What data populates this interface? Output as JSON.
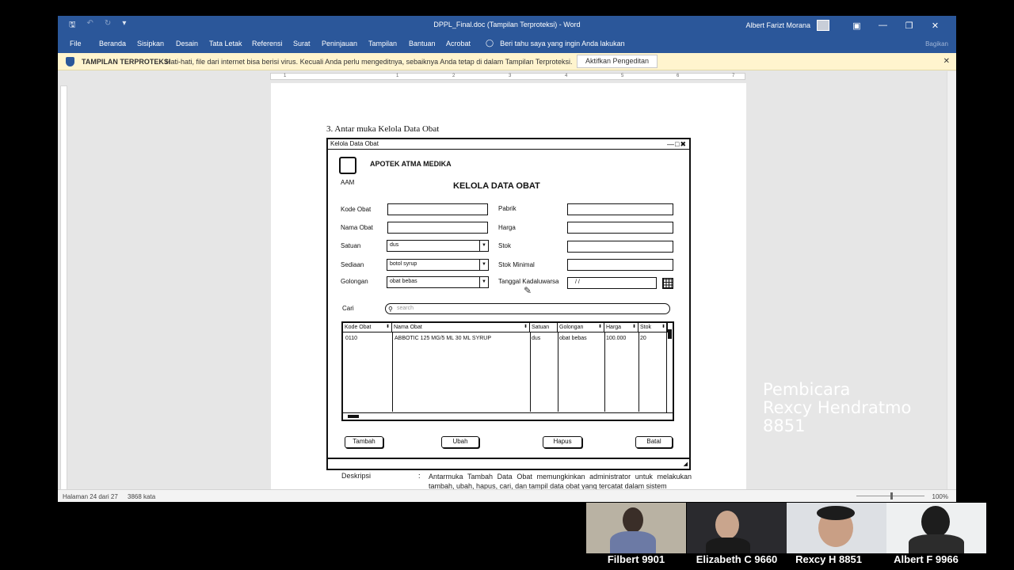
{
  "window": {
    "title": "DPPL_Final.doc (Tampilan Terproteksi) - Word",
    "user": "Albert Farizt Morana"
  },
  "menu": {
    "items": [
      "File",
      "Beranda",
      "Sisipkan",
      "Desain",
      "Tata Letak",
      "Referensi",
      "Surat",
      "Peninjauan",
      "Tampilan",
      "Bantuan",
      "Acrobat"
    ],
    "tell_me": "Beri tahu saya yang ingin Anda lakukan",
    "share": "Bagikan"
  },
  "infobar": {
    "title": "TAMPILAN TERPROTEKSI",
    "message": "Hati-hati, file dari internet bisa berisi virus. Kecuali Anda perlu mengeditnya, sebaiknya Anda tetap di dalam Tampilan Terproteksi.",
    "button": "Aktifkan Pengeditan"
  },
  "ruler": {
    "marks": [
      "1",
      "1",
      "2",
      "3",
      "4",
      "5",
      "6",
      "7"
    ]
  },
  "document": {
    "heading": "3.   Antar muka Kelola Data Obat",
    "mockup": {
      "window_title": "Kelola Data Obat",
      "store_name": "APOTEK ATMA MEDIKA",
      "logo_abbr": "AAM",
      "form_title": "KELOLA DATA OBAT",
      "fields": {
        "kode_obat": "Kode Obat",
        "nama_obat": "Nama Obat",
        "satuan": "Satuan",
        "sediaan": "Sediaan",
        "golongan": "Golongan",
        "pabrik": "Pabrik",
        "harga": "Harga",
        "stok": "Stok",
        "stok_minimal": "Stok Minimal",
        "tanggal": "Tanggal Kadaluwarsa"
      },
      "values": {
        "satuan": "dus",
        "sediaan": "botol syrup",
        "golongan": "obat bebas",
        "tanggal": "/ /"
      },
      "search": {
        "label": "Cari",
        "placeholder": "search"
      },
      "table": {
        "headers": [
          "Kode Obat",
          "Nama Obat",
          "Satuan",
          "Golongan",
          "Harga",
          "Stok"
        ],
        "rows": [
          [
            "0110",
            "ABBOTIC 125 MG/5 ML 30 ML SYRUP",
            "dus",
            "obat bebas",
            "100.000",
            "20"
          ]
        ]
      },
      "buttons": [
        "Tambah",
        "Ubah",
        "Hapus",
        "Batal"
      ]
    },
    "description_label": "Deskripsi",
    "description_colon": ":",
    "description_text": "Antarmuka Tambah Data Obat memungkinkan administrator untuk melakukan tambah, ubah, hapus, cari, dan tampil data obat yang tercatat dalam sistem"
  },
  "status": {
    "page": "Halaman 24 dari 27",
    "words": "3868 kata",
    "zoom": "100%"
  },
  "speaker": {
    "line1": "Pembicara",
    "line2": "Rexcy Hendratmo",
    "line3": "8851"
  },
  "participants": [
    "Filbert 9901",
    "Elizabeth C 9660",
    "Rexcy H 8851",
    "Albert F 9966"
  ]
}
